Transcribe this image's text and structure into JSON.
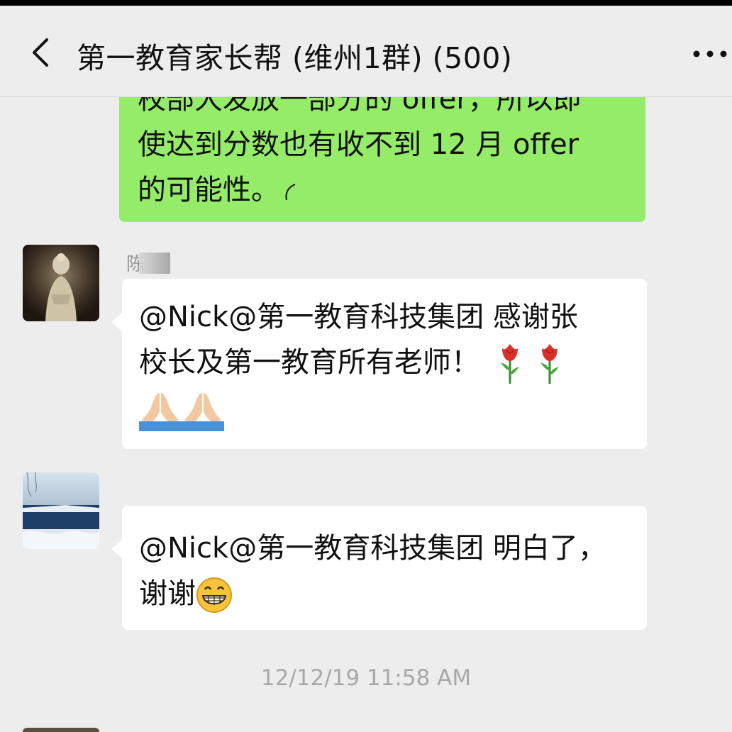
{
  "header": {
    "title": "第一教育家长帮 (维州1群) (500)",
    "back_icon": "chevron-left-icon",
    "more_icon": "more-dots-icon"
  },
  "messages": [
    {
      "type": "self",
      "lines": [
        "校部大发放一部分的 offer，所以即",
        "使达到分数也有收不到 12 月 offer",
        "的可能性。"
      ]
    },
    {
      "type": "other",
      "sender": "陈",
      "lines": [
        "@Nick@第一教育科技集团  感谢张",
        "校长及第一教育所有老师！"
      ],
      "emojis": [
        "rose-icon",
        "rose-icon",
        "folded-hands-icon",
        "folded-hands-icon"
      ]
    },
    {
      "type": "other",
      "sender": "",
      "lines": [
        "@Nick@第一教育科技集团 明白了，",
        "谢谢"
      ],
      "emojis": [
        "grin-icon"
      ]
    }
  ],
  "timestamp": "12/12/19 11:58 AM",
  "colors": {
    "background": "#ededed",
    "self_bubble": "#95ec69",
    "other_bubble": "#ffffff"
  }
}
